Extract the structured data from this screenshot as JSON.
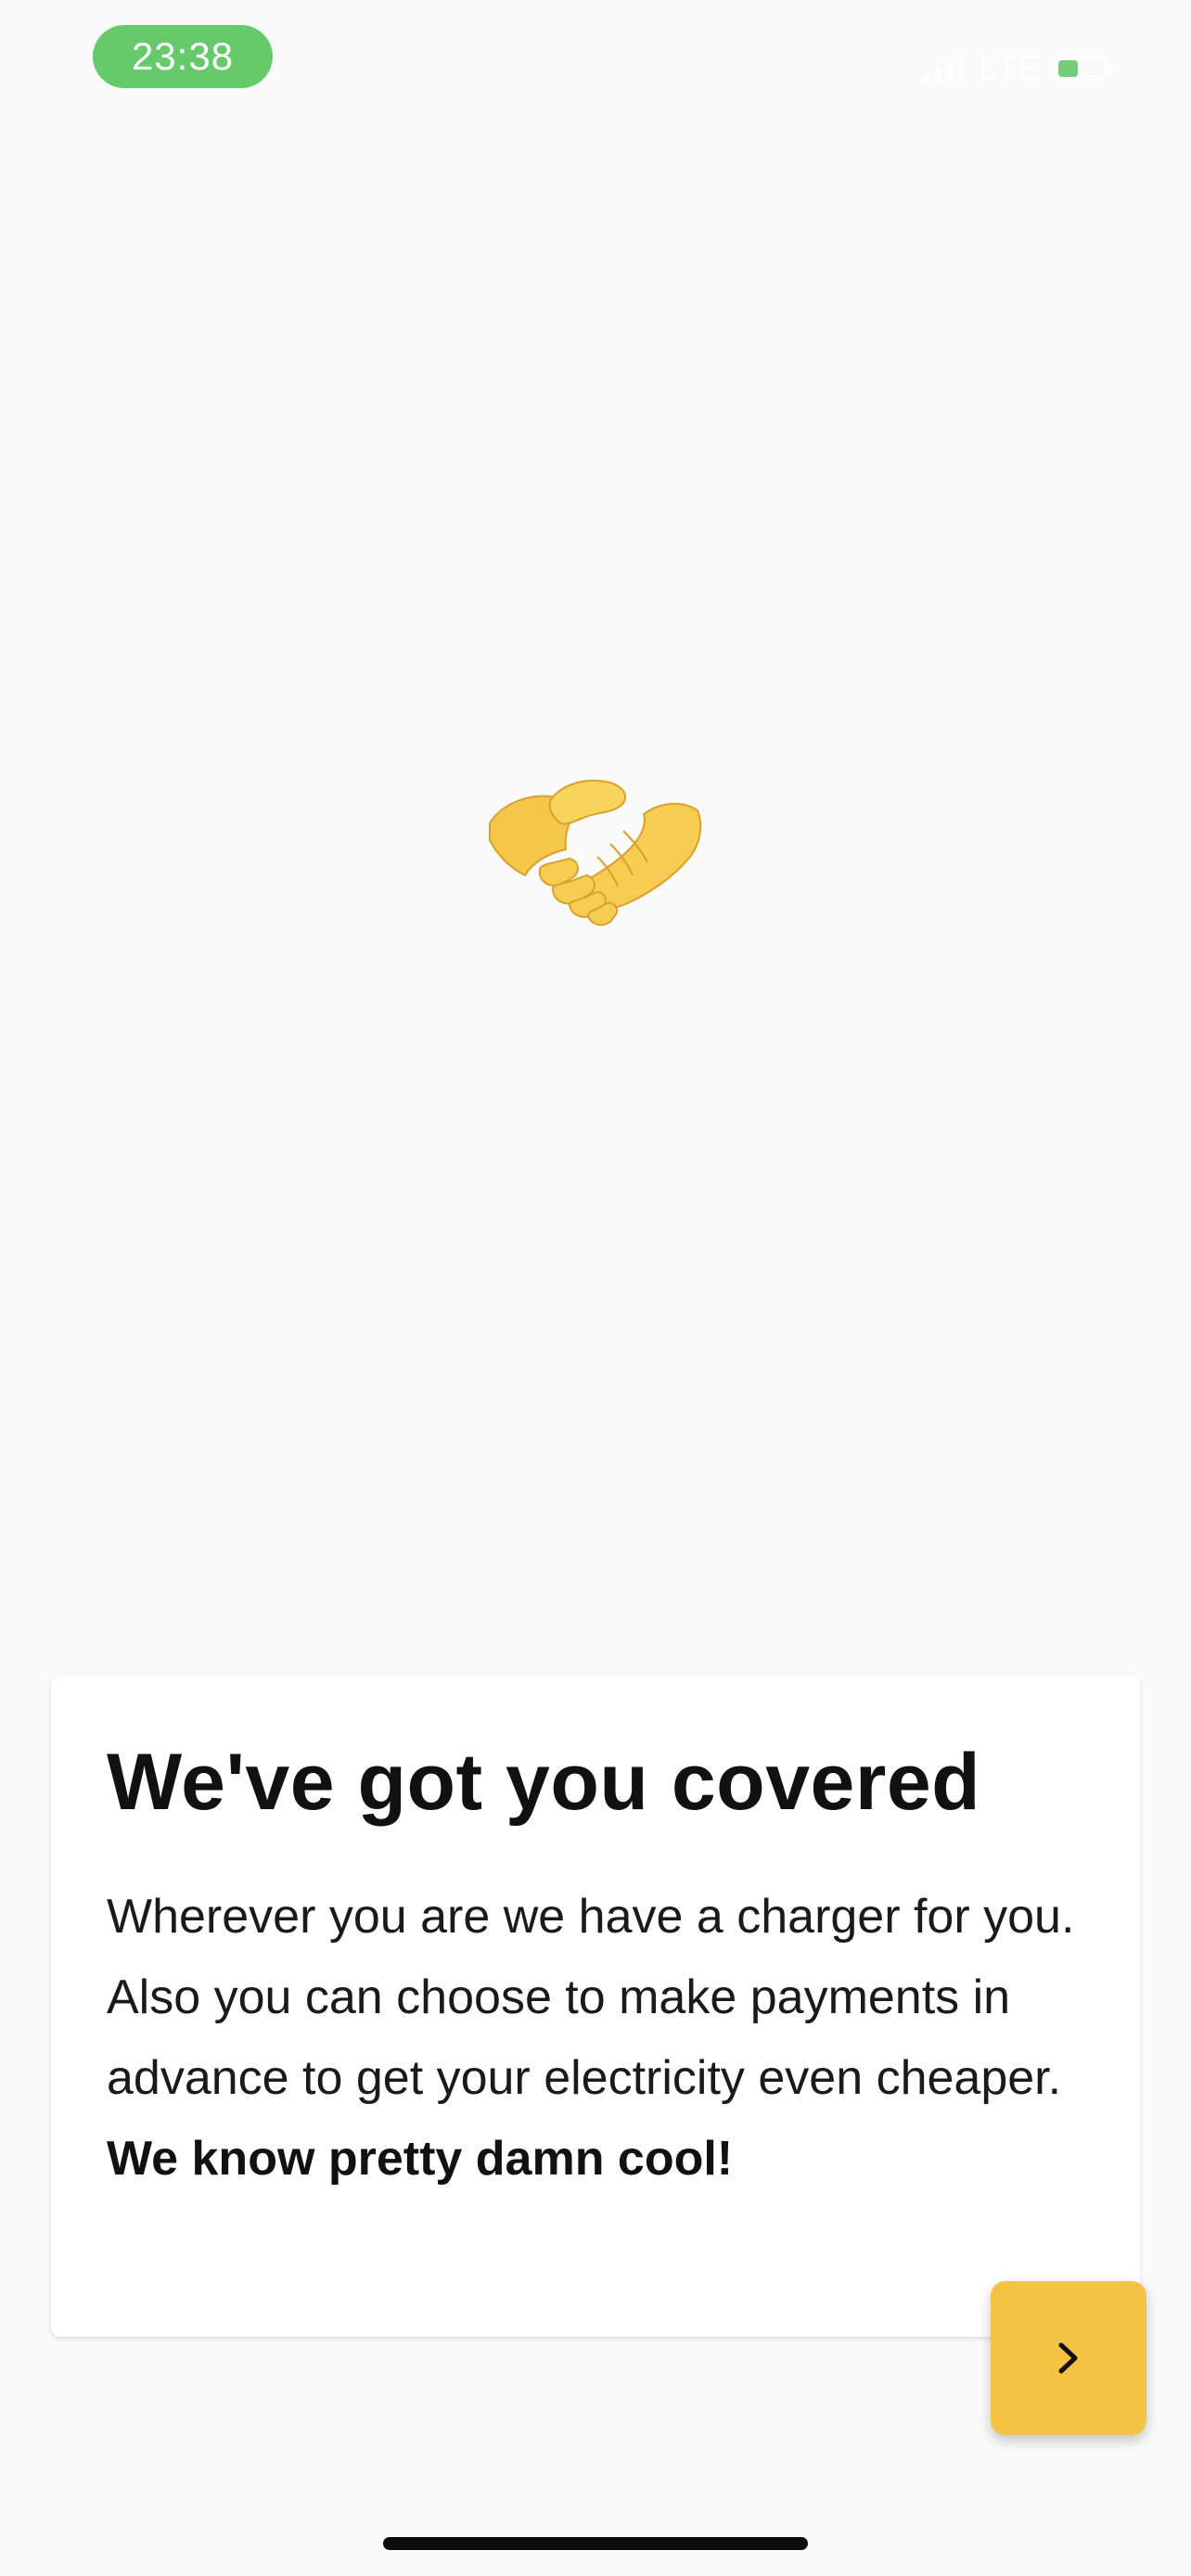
{
  "status_bar": {
    "time": "23:38",
    "network": "LTE",
    "time_pill_color": "#66c96a",
    "battery_level": 0.4
  },
  "hero": {
    "icon": "handshake-icon",
    "emoji": "🤝"
  },
  "card": {
    "title": "We've got you covered",
    "body": "Wherever you are we have a charger for you. Also you can choose to make payments in advance to get your electricity even cheaper.",
    "body_emphasis": "We know pretty damn cool!"
  },
  "next_button": {
    "icon": "chevron-right-icon",
    "color": "#f5c344"
  },
  "colors": {
    "background": "#fafafa",
    "accent": "#f5c344",
    "status_green": "#66c96a"
  }
}
